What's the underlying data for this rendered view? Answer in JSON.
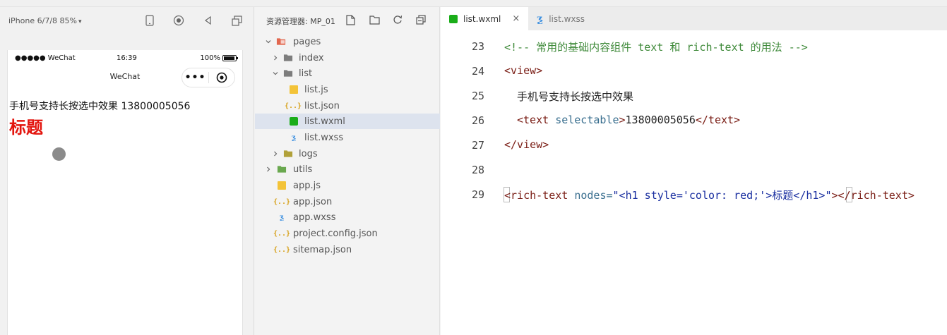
{
  "simulator": {
    "device": "iPhone 6/7/8 85%",
    "status": {
      "carrier": "●●●●● WeChat",
      "time": "16:39",
      "battery": "100%"
    },
    "nav_title": "WeChat",
    "content_line": "手机号支持长按选中效果 13800005056",
    "heading": "标题",
    "colors": {
      "heading": "#e3140d"
    }
  },
  "explorer": {
    "title": "资源管理器: MP_01",
    "tree": [
      {
        "label": "pages",
        "type": "folder-open",
        "depth": 0
      },
      {
        "label": "index",
        "type": "folder",
        "depth": 1
      },
      {
        "label": "list",
        "type": "folder-open",
        "depth": 1
      },
      {
        "label": "list.js",
        "type": "js",
        "depth": 2
      },
      {
        "label": "list.json",
        "type": "json",
        "depth": 2
      },
      {
        "label": "list.wxml",
        "type": "wxml",
        "depth": 2,
        "selected": true
      },
      {
        "label": "list.wxss",
        "type": "wxss",
        "depth": 2
      },
      {
        "label": "logs",
        "type": "folder",
        "depth": 1
      },
      {
        "label": "utils",
        "type": "folder",
        "depth": 0
      },
      {
        "label": "app.js",
        "type": "js",
        "depth": 0
      },
      {
        "label": "app.json",
        "type": "json",
        "depth": 0
      },
      {
        "label": "app.wxss",
        "type": "wxss",
        "depth": 0
      },
      {
        "label": "project.config.json",
        "type": "json",
        "depth": 0
      },
      {
        "label": "sitemap.json",
        "type": "json",
        "depth": 0
      }
    ]
  },
  "editor": {
    "tabs": [
      {
        "label": "list.wxml",
        "active": true
      },
      {
        "label": "list.wxss",
        "active": false
      }
    ],
    "close_glyph": "×",
    "lines": {
      "l23": {
        "num": "23",
        "comment": "<!-- 常用的基础内容组件 text 和 rich-text 的用法 -->"
      },
      "l24": {
        "num": "24",
        "tag": "<view>"
      },
      "l25": {
        "num": "25",
        "text": "手机号支持长按选中效果"
      },
      "l26": {
        "num": "26",
        "open": "<text ",
        "attr": "selectable",
        "gt": ">",
        "body": "13800005056",
        "close": "</text>"
      },
      "l27": {
        "num": "27",
        "tag": "</view>"
      },
      "l28": {
        "num": "28"
      },
      "l29": {
        "num": "29",
        "open": "<rich-text ",
        "attr": "nodes=",
        "str": "\"<h1 style='color: red;'>标题</h1>\"",
        "gt": ">",
        "close": "</rich-text>"
      }
    }
  }
}
